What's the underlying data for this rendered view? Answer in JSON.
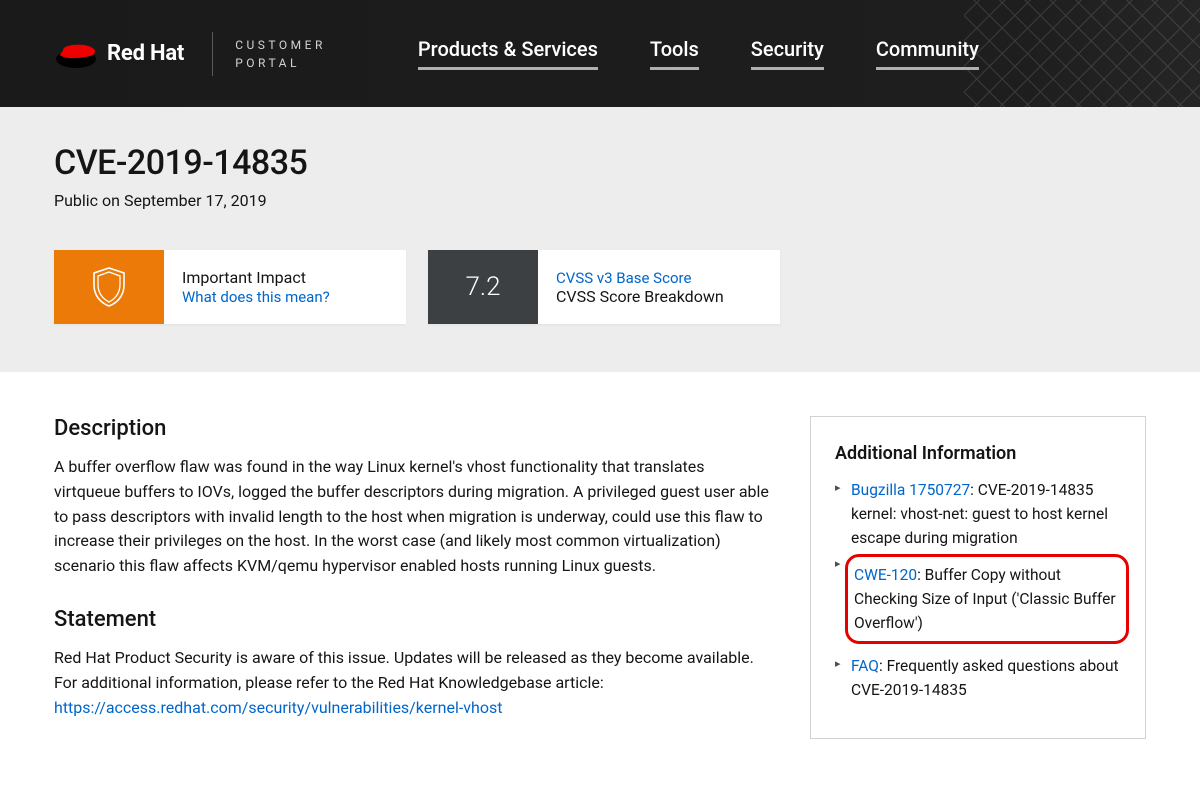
{
  "header": {
    "brand": "Red Hat",
    "portal_line1": "CUSTOMER",
    "portal_line2": "PORTAL",
    "nav": [
      "Products & Services",
      "Tools",
      "Security",
      "Community"
    ]
  },
  "band": {
    "title": "CVE-2019-14835",
    "date_prefix": "Public on ",
    "date": "September 17, 2019",
    "impact_label": "Important Impact",
    "impact_help": "What does this mean?",
    "score": "7.2",
    "score_line1": "CVSS v3 Base Score",
    "score_line2": "CVSS Score Breakdown"
  },
  "description": {
    "heading": "Description",
    "body": "A buffer overflow flaw was found in the way Linux kernel's vhost functionality that translates virtqueue buffers to IOVs, logged the buffer descriptors during migration. A privileged guest user able to pass descriptors with invalid length to the host when migration is underway, could use this flaw to increase their privileges on the host. In the worst case (and likely most common virtualization) scenario this flaw affects KVM/qemu hypervisor enabled hosts running Linux guests."
  },
  "statement": {
    "heading": "Statement",
    "body": "Red Hat Product Security is aware of this issue. Updates will be released as they become available. For additional information, please refer to the Red Hat Knowledgebase article:",
    "link": "https://access.redhat.com/security/vulnerabilities/kernel-vhost"
  },
  "sidebar": {
    "heading": "Additional Information",
    "items": [
      {
        "link": "Bugzilla 1750727",
        "text": ": CVE-2019-14835 kernel: vhost-net: guest to host kernel escape during migration",
        "highlight": false
      },
      {
        "link": "CWE-120",
        "text": ": Buffer Copy without Checking Size of Input ('Classic Buffer Overflow')",
        "highlight": true
      },
      {
        "link": "FAQ",
        "text": ": Frequently asked questions about CVE-2019-14835",
        "highlight": false
      }
    ]
  }
}
